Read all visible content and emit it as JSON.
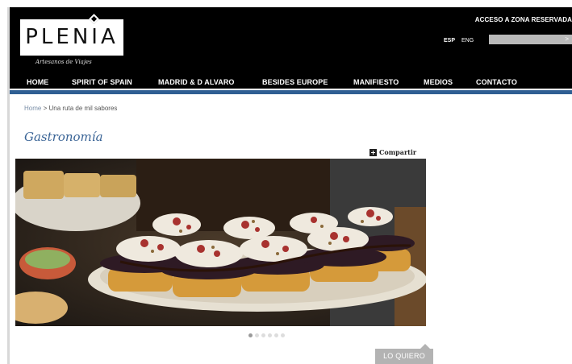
{
  "header": {
    "logo_text": "PLENIA",
    "tagline": "Artesanos de Viajes",
    "reserved_link": "ACCESO A ZONA RESERVADA",
    "languages": {
      "esp": "ESP",
      "eng": "ENG"
    },
    "search_arrow": ">"
  },
  "nav": {
    "items": [
      {
        "label": "HOME"
      },
      {
        "label": "SPIRIT OF SPAIN"
      },
      {
        "label": "MADRID & D ALVARO"
      },
      {
        "label": "BESIDES EUROPE"
      },
      {
        "label": "MANIFIESTO"
      },
      {
        "label": "MEDIOS"
      },
      {
        "label": "CONTACTO"
      }
    ]
  },
  "breadcrumb": {
    "home": "Home",
    "separator": ">",
    "current": "Una ruta de mil sabores"
  },
  "main": {
    "title": "Gastronomía",
    "share_label": "Compartir",
    "carousel": {
      "active_index": 0
    },
    "cta_label": "LO QUIERO"
  },
  "colors": {
    "nav_bg": "#000000",
    "accent_blue": "#2f5f93",
    "title_blue": "#3a6496",
    "cta_gray": "#b3b3b3"
  }
}
